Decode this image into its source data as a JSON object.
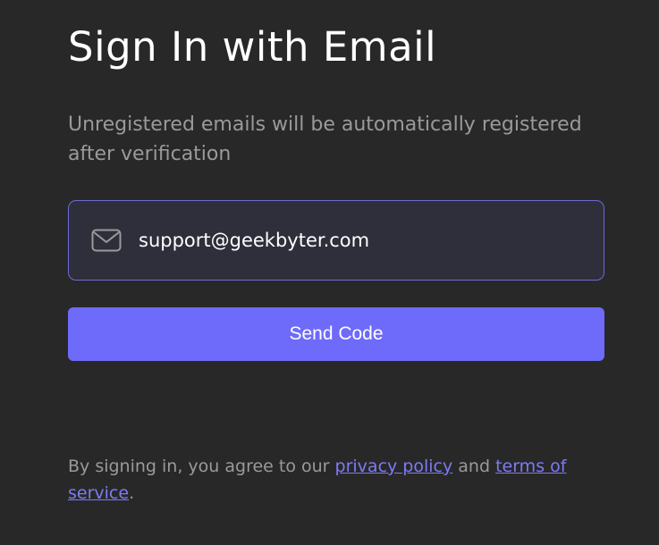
{
  "title": "Sign In with Email",
  "subtitle": "Unregistered emails will be automatically registered after verification",
  "email_field": {
    "icon": "mail-icon",
    "value": "support@geekbyter.com"
  },
  "send_button": {
    "label": "Send Code"
  },
  "terms": {
    "prefix": "By signing in, you agree to our ",
    "privacy_link": "privacy policy",
    "middle": " and ",
    "terms_link": "terms of service",
    "suffix": "."
  },
  "colors": {
    "background": "#282828",
    "accent": "#6e6bfa",
    "input_border": "#6b6bd6",
    "link": "#7d7bf5"
  }
}
